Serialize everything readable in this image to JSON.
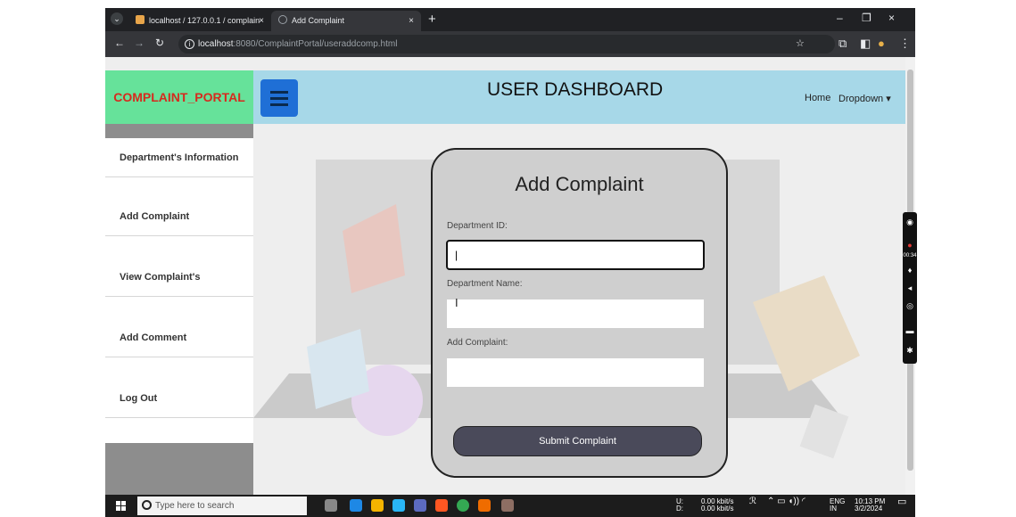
{
  "browser": {
    "tabs": [
      {
        "label": "localhost / 127.0.0.1 / complain",
        "close": "×"
      },
      {
        "label": "Add Complaint",
        "close": "×"
      }
    ],
    "new_tab": "+",
    "window_controls": {
      "minimize": "–",
      "restore": "❐",
      "close": "×"
    },
    "url_host": "localhost",
    "url_rest": ":8080/ComplaintPortal/useraddcomp.html"
  },
  "app": {
    "brand": "COMPLAINT_PORTAL",
    "title": "USER DASHBOARD",
    "nav": {
      "home": "Home",
      "dropdown": "Dropdown ▾"
    },
    "sidebar": [
      {
        "label": "Department's Information"
      },
      {
        "label": "Add Complaint"
      },
      {
        "label": "View Complaint's"
      },
      {
        "label": "Add Comment"
      },
      {
        "label": "Log Out"
      }
    ],
    "colors": {
      "brand_bg": "#66e29a",
      "brand_text": "#d62a1e",
      "header_bg": "#a7d8e8",
      "menu_button": "#1f6fd6",
      "submit_bg": "#4a4a5a"
    }
  },
  "form": {
    "title": "Add Complaint",
    "fields": [
      {
        "label": "Department ID:",
        "value": "|"
      },
      {
        "label": "Department Name:",
        "value": ""
      },
      {
        "label": "Add Complaint:",
        "value": ""
      }
    ],
    "submit_label": "Submit Complaint"
  },
  "taskbar": {
    "search_placeholder": "Type here to search",
    "net_up": "0.00 kbit/s",
    "net_down": "0.00 kbit/s",
    "net_up_label": "U:",
    "net_down_label": "D:",
    "lang": "ENG",
    "region": "IN",
    "time": "10:13 PM",
    "date": "3/2/2024"
  },
  "recorder": {
    "timer": "00:34"
  }
}
